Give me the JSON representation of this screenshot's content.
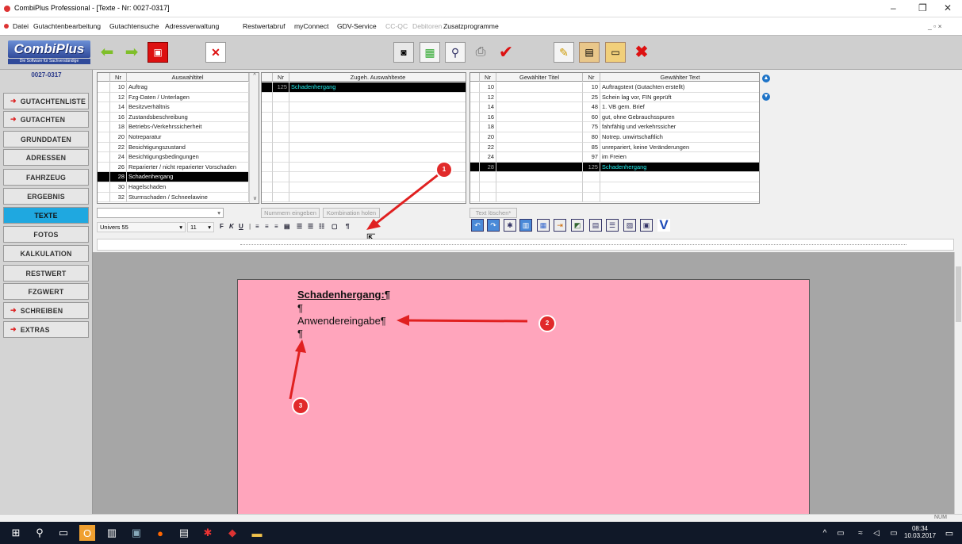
{
  "window": {
    "title": "CombiPlus Professional - [Texte - Nr: 0027-0317]",
    "minimize": "–",
    "restore": "❐",
    "close": "✕"
  },
  "menu": {
    "items": [
      "Datei",
      "Gutachtenbearbeitung",
      "Gutachtensuche",
      "Adressverwaltung",
      "Restwertabruf",
      "myConnect",
      "GDV-Service",
      "CC-QC",
      "Debitoren",
      "Zusatzprogramme"
    ],
    "disabled": [
      "CC-QC",
      "Debitoren"
    ],
    "right_controls": "_ ▫ ×"
  },
  "logo": {
    "title": "CombiPlus",
    "subtitle": "Die Software für Sachverständige"
  },
  "sidebar": {
    "record_id": "0027-0317",
    "items": [
      {
        "label": "GUTACHTENLISTE",
        "arrow": true
      },
      {
        "label": "GUTACHTEN",
        "arrow": true
      },
      {
        "label": "GRUNDDATEN",
        "arrow": false
      },
      {
        "label": "ADRESSEN",
        "arrow": false
      },
      {
        "label": "FAHRZEUG",
        "arrow": false
      },
      {
        "label": "ERGEBNIS",
        "arrow": false
      },
      {
        "label": "TEXTE",
        "arrow": false,
        "active": true
      },
      {
        "label": "FOTOS",
        "arrow": false
      },
      {
        "label": "KALKULATION",
        "arrow": false
      },
      {
        "label": "RESTWERT",
        "arrow": false
      },
      {
        "label": "FZGWERT",
        "arrow": false
      },
      {
        "label": "SCHREIBEN",
        "arrow": true
      },
      {
        "label": "EXTRAS",
        "arrow": true
      }
    ]
  },
  "grid1": {
    "headers": [
      "Nr",
      "Auswahltitel"
    ],
    "rows": [
      [
        "10",
        "Auftrag"
      ],
      [
        "12",
        "Fzg-Daten / Unterlagen"
      ],
      [
        "14",
        "Besitzverhältnis"
      ],
      [
        "16",
        "Zustandsbeschreibung"
      ],
      [
        "18",
        "Betriebs-/Verkehrssicherheit"
      ],
      [
        "20",
        "Notreparatur"
      ],
      [
        "22",
        "Besichtigungszustand"
      ],
      [
        "24",
        "Besichtigungsbedingungen"
      ],
      [
        "26",
        "Reparierter / nicht reparierter Vorschaden"
      ],
      [
        "28",
        "Schadenhergang"
      ],
      [
        "30",
        "Hagelschaden"
      ],
      [
        "32",
        "Sturmschaden / Schneelawine"
      ]
    ],
    "selected_index": 9
  },
  "grid2": {
    "headers": [
      "Nr",
      "Zugeh. Auswahltexte"
    ],
    "rows": [
      [
        "125",
        "Schadenhergang"
      ]
    ]
  },
  "grid3": {
    "headers": [
      "Nr",
      "Gewählter Titel",
      "Nr",
      "Gewählter Text"
    ],
    "rows": [
      [
        "10",
        "",
        "10",
        "Auftragstext (Gutachten erstellt)"
      ],
      [
        "12",
        "",
        "25",
        "Schein lag vor, FIN geprüft"
      ],
      [
        "14",
        "",
        "48",
        "1. VB gem. Brief"
      ],
      [
        "16",
        "",
        "60",
        "gut, ohne Gebrauchsspuren"
      ],
      [
        "18",
        "",
        "75",
        "fahrfähig und verkehrssicher"
      ],
      [
        "20",
        "",
        "80",
        "Notrep. unwirtschaftlich"
      ],
      [
        "22",
        "",
        "85",
        "unrepariert, keine Veränderungen"
      ],
      [
        "24",
        "",
        "97",
        "im Freien"
      ],
      [
        "28",
        "",
        "125",
        "Schadenhergang"
      ]
    ],
    "selected_index": 8
  },
  "controls": {
    "btn_nummern": "Nummern eingeben",
    "btn_kombination": "Kombination holen",
    "btn_text_loeschen": "Text löschen*",
    "font_name": "Univers 55",
    "font_size": "11",
    "fmt_bold": "F",
    "fmt_italic": "K",
    "fmt_underline": "U",
    "pilcrow": "¶"
  },
  "document": {
    "heading": "Schadenhergang:¶",
    "line1": "¶",
    "line2": "Anwendereingabe¶",
    "line3": "¶"
  },
  "annotations": [
    "1",
    "2",
    "3"
  ],
  "status": {
    "num": "NUM"
  },
  "taskbar": {
    "time": "08:34",
    "date": "10.03.2017"
  }
}
